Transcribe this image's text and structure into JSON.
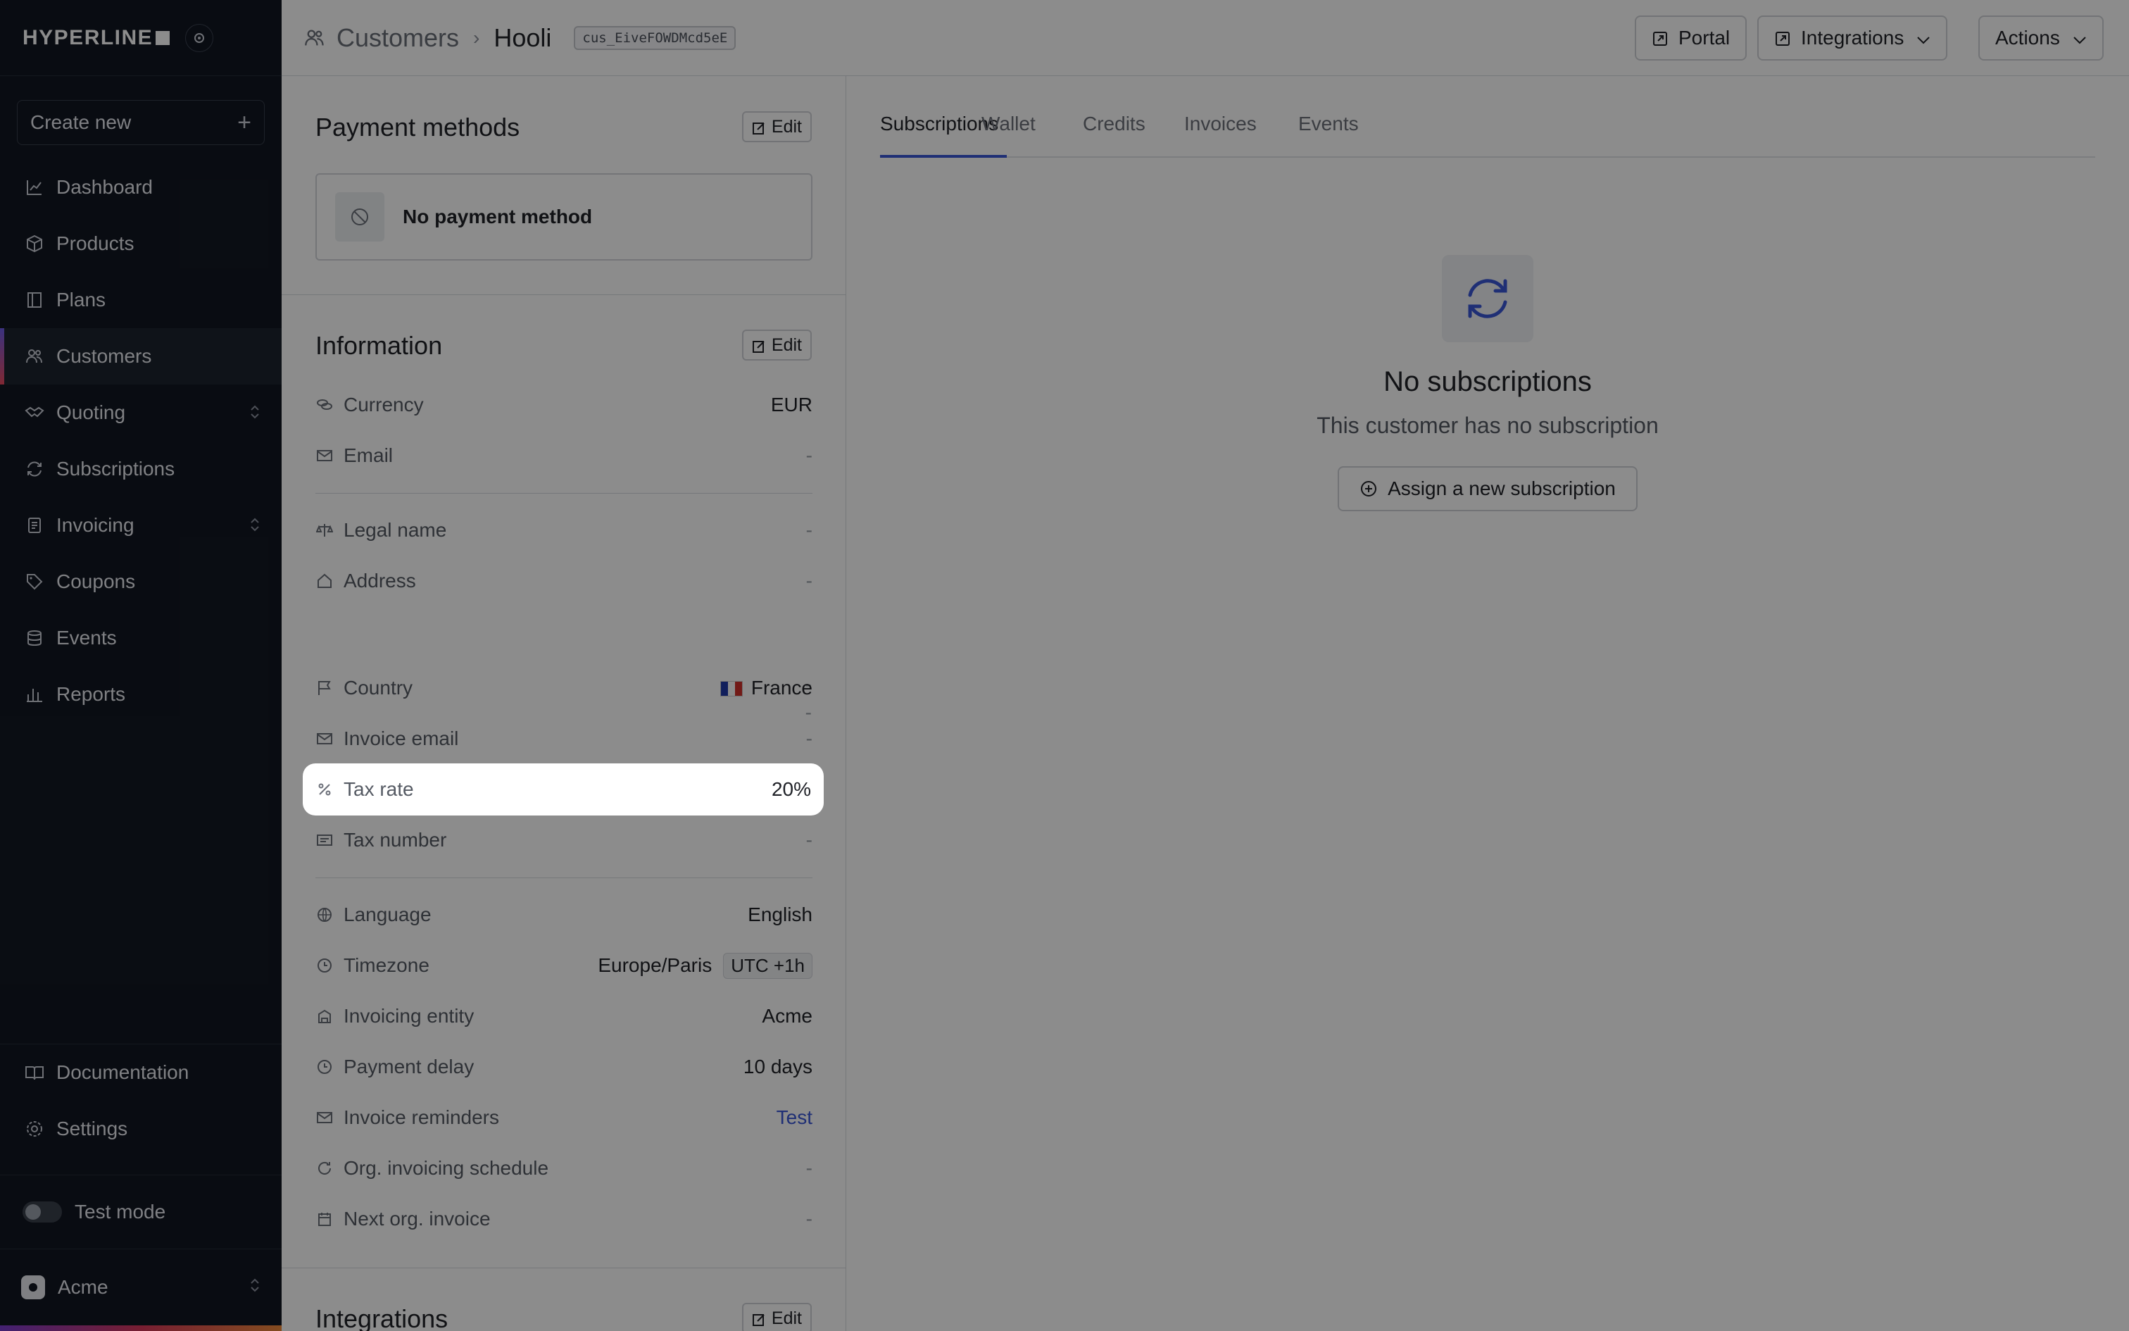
{
  "sidebar": {
    "brand": "HYPERLINE",
    "create_new": "Create new",
    "items": [
      {
        "label": "Dashboard",
        "icon": "chart-line-icon"
      },
      {
        "label": "Products",
        "icon": "box-icon"
      },
      {
        "label": "Plans",
        "icon": "book-icon"
      },
      {
        "label": "Customers",
        "icon": "users-icon",
        "active": true
      },
      {
        "label": "Quoting",
        "icon": "handshake-icon",
        "expandable": true
      },
      {
        "label": "Subscriptions",
        "icon": "refresh-icon"
      },
      {
        "label": "Invoicing",
        "icon": "invoice-icon",
        "expandable": true
      },
      {
        "label": "Coupons",
        "icon": "tag-icon"
      },
      {
        "label": "Events",
        "icon": "database-icon"
      },
      {
        "label": "Reports",
        "icon": "bar-chart-icon"
      }
    ],
    "bottom": [
      {
        "label": "Documentation",
        "icon": "book-open-icon"
      },
      {
        "label": "Settings",
        "icon": "gear-icon"
      }
    ],
    "test_mode": "Test mode",
    "workspace": "Acme"
  },
  "header": {
    "breadcrumb_root": "Customers",
    "breadcrumb_current": "Hooli",
    "customer_id": "cus_EiveFOWDMcd5eE",
    "portal": "Portal",
    "integrations": "Integrations",
    "actions": "Actions"
  },
  "payment_methods": {
    "title": "Payment methods",
    "edit": "Edit",
    "empty": "No payment method"
  },
  "information": {
    "title": "Information",
    "edit": "Edit",
    "currency": {
      "label": "Currency",
      "value": "EUR"
    },
    "email": {
      "label": "Email",
      "value": "-"
    },
    "legal_name": {
      "label": "Legal name",
      "value": "-"
    },
    "address": {
      "label": "Address",
      "lines": [
        "-",
        "-",
        "-"
      ]
    },
    "country": {
      "label": "Country",
      "value": "France"
    },
    "invoice_email": {
      "label": "Invoice email",
      "value": "-"
    },
    "tax_rate": {
      "label": "Tax rate",
      "value": "20%"
    },
    "tax_number": {
      "label": "Tax number",
      "value": "-"
    },
    "language": {
      "label": "Language",
      "value": "English"
    },
    "timezone": {
      "label": "Timezone",
      "value": "Europe/Paris",
      "offset": "UTC +1h"
    },
    "invoicing_entity": {
      "label": "Invoicing entity",
      "value": "Acme"
    },
    "payment_delay": {
      "label": "Payment delay",
      "value": "10 days"
    },
    "invoice_reminders": {
      "label": "Invoice reminders",
      "value": "Test"
    },
    "org_invoicing_schedule": {
      "label": "Org. invoicing schedule",
      "value": "-"
    },
    "next_org_invoice": {
      "label": "Next org. invoice",
      "value": "-"
    }
  },
  "integrations": {
    "title": "Integrations",
    "edit": "Edit"
  },
  "tabs": [
    "Subscriptions",
    "Wallet",
    "Credits",
    "Invoices",
    "Events"
  ],
  "empty_state": {
    "title": "No subscriptions",
    "subtitle": "This customer has no subscription",
    "button": "Assign a new subscription"
  },
  "colors": {
    "accent": "#3a57d6",
    "sidebar_bg": "#121722"
  }
}
